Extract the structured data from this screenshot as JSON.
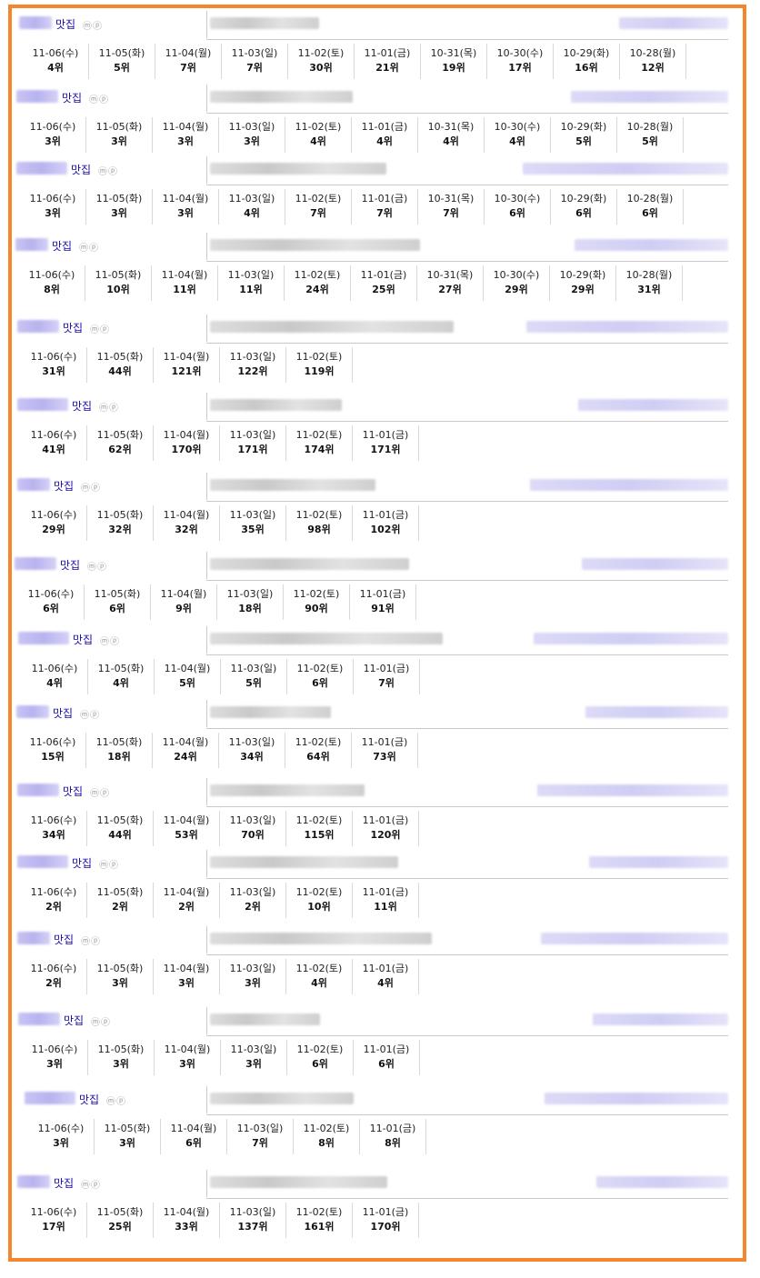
{
  "keyword_suffix": "맛집",
  "badge": "ⓜⓟ",
  "rank_unit": "위",
  "entries": [
    {
      "days": [
        "11-06(수)",
        "11-05(화)",
        "11-04(월)",
        "11-03(일)",
        "11-02(토)",
        "11-01(금)",
        "10-31(목)",
        "10-30(수)",
        "10-29(화)",
        "10-28(월)"
      ],
      "ranks": [
        "4",
        "5",
        "7",
        "7",
        "30",
        "21",
        "19",
        "17",
        "16",
        "12"
      ]
    },
    {
      "days": [
        "11-06(수)",
        "11-05(화)",
        "11-04(월)",
        "11-03(일)",
        "11-02(토)",
        "11-01(금)",
        "10-31(목)",
        "10-30(수)",
        "10-29(화)",
        "10-28(월)"
      ],
      "ranks": [
        "3",
        "3",
        "3",
        "3",
        "4",
        "4",
        "4",
        "4",
        "5",
        "5"
      ]
    },
    {
      "days": [
        "11-06(수)",
        "11-05(화)",
        "11-04(월)",
        "11-03(일)",
        "11-02(토)",
        "11-01(금)",
        "10-31(목)",
        "10-30(수)",
        "10-29(화)",
        "10-28(월)"
      ],
      "ranks": [
        "3",
        "3",
        "3",
        "4",
        "7",
        "7",
        "7",
        "6",
        "6",
        "6"
      ]
    },
    {
      "days": [
        "11-06(수)",
        "11-05(화)",
        "11-04(월)",
        "11-03(일)",
        "11-02(토)",
        "11-01(금)",
        "10-31(목)",
        "10-30(수)",
        "10-29(화)",
        "10-28(월)"
      ],
      "ranks": [
        "8",
        "10",
        "11",
        "11",
        "24",
        "25",
        "27",
        "29",
        "29",
        "31"
      ]
    },
    {
      "days": [
        "11-06(수)",
        "11-05(화)",
        "11-04(월)",
        "11-03(일)",
        "11-02(토)"
      ],
      "ranks": [
        "31",
        "44",
        "121",
        "122",
        "119"
      ]
    },
    {
      "days": [
        "11-06(수)",
        "11-05(화)",
        "11-04(월)",
        "11-03(일)",
        "11-02(토)",
        "11-01(금)"
      ],
      "ranks": [
        "41",
        "62",
        "170",
        "171",
        "174",
        "171"
      ]
    },
    {
      "days": [
        "11-06(수)",
        "11-05(화)",
        "11-04(월)",
        "11-03(일)",
        "11-02(토)",
        "11-01(금)"
      ],
      "ranks": [
        "29",
        "32",
        "32",
        "35",
        "98",
        "102"
      ]
    },
    {
      "days": [
        "11-06(수)",
        "11-05(화)",
        "11-04(월)",
        "11-03(일)",
        "11-02(토)",
        "11-01(금)"
      ],
      "ranks": [
        "6",
        "6",
        "9",
        "18",
        "90",
        "91"
      ]
    },
    {
      "days": [
        "11-06(수)",
        "11-05(화)",
        "11-04(월)",
        "11-03(일)",
        "11-02(토)",
        "11-01(금)"
      ],
      "ranks": [
        "4",
        "4",
        "5",
        "5",
        "6",
        "7"
      ]
    },
    {
      "days": [
        "11-06(수)",
        "11-05(화)",
        "11-04(월)",
        "11-03(일)",
        "11-02(토)",
        "11-01(금)"
      ],
      "ranks": [
        "15",
        "18",
        "24",
        "34",
        "64",
        "73"
      ]
    },
    {
      "days": [
        "11-06(수)",
        "11-05(화)",
        "11-04(월)",
        "11-03(일)",
        "11-02(토)",
        "11-01(금)"
      ],
      "ranks": [
        "34",
        "44",
        "53",
        "70",
        "115",
        "120"
      ]
    },
    {
      "days": [
        "11-06(수)",
        "11-05(화)",
        "11-04(월)",
        "11-03(일)",
        "11-02(토)",
        "11-01(금)"
      ],
      "ranks": [
        "2",
        "2",
        "2",
        "2",
        "10",
        "11"
      ]
    },
    {
      "days": [
        "11-06(수)",
        "11-05(화)",
        "11-04(월)",
        "11-03(일)",
        "11-02(토)",
        "11-01(금)"
      ],
      "ranks": [
        "2",
        "3",
        "3",
        "3",
        "4",
        "4"
      ]
    },
    {
      "days": [
        "11-06(수)",
        "11-05(화)",
        "11-04(월)",
        "11-03(일)",
        "11-02(토)",
        "11-01(금)"
      ],
      "ranks": [
        "3",
        "3",
        "3",
        "3",
        "6",
        "6"
      ]
    },
    {
      "days": [
        "11-06(수)",
        "11-05(화)",
        "11-04(월)",
        "11-03(일)",
        "11-02(토)",
        "11-01(금)"
      ],
      "ranks": [
        "3",
        "3",
        "6",
        "7",
        "8",
        "8"
      ]
    },
    {
      "days": [
        "11-06(수)",
        "11-05(화)",
        "11-04(월)",
        "11-03(일)",
        "11-02(토)",
        "11-01(금)"
      ],
      "ranks": [
        "17",
        "25",
        "33",
        "137",
        "161",
        "170"
      ]
    }
  ]
}
